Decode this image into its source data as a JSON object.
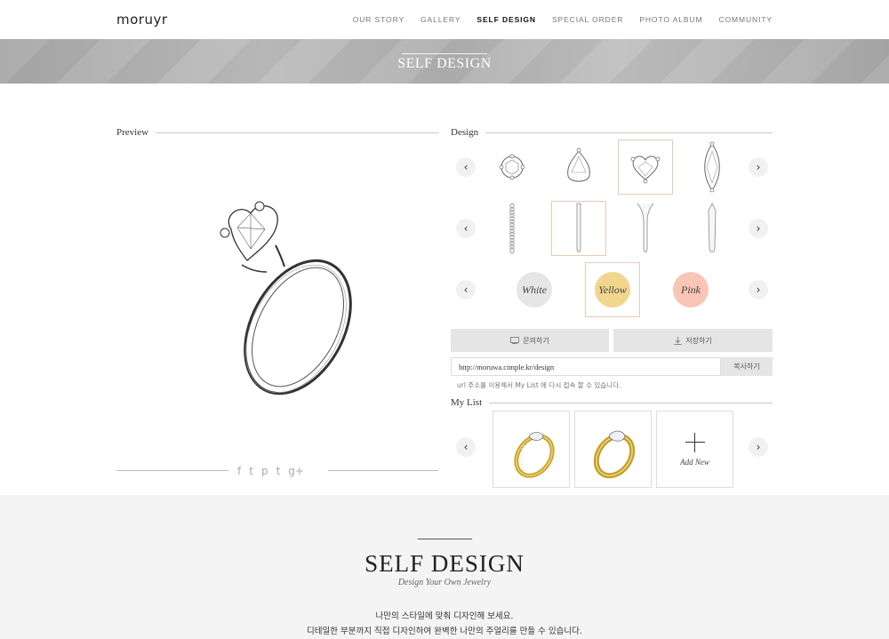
{
  "header": {
    "logo": "moruyr",
    "nav": [
      "OUR STORY",
      "GALLERY",
      "SELF DESIGN",
      "SPECIAL ORDER",
      "PHOTO ALBUM",
      "COMMUNITY"
    ],
    "active_nav": "SELF DESIGN"
  },
  "banner": {
    "title": "SELF DESIGN"
  },
  "preview": {
    "heading": "Preview",
    "share_icons": [
      "facebook-icon",
      "twitter-icon",
      "pinterest-icon",
      "tumblr-icon",
      "google-plus-icon"
    ],
    "share_glyphs": [
      "f",
      "t",
      "p",
      "t",
      "g+"
    ]
  },
  "design": {
    "heading": "Design",
    "shapes": [
      "round",
      "pear",
      "heart",
      "marquise"
    ],
    "selected_shape": "heart",
    "bands": [
      "pave",
      "plain-selected",
      "split",
      "tapered"
    ],
    "colors": [
      {
        "label": "White",
        "hex": "#e6e6e6"
      },
      {
        "label": "Yellow",
        "hex": "#f2d68d"
      },
      {
        "label": "Pink",
        "hex": "#f8c5b6"
      }
    ],
    "selected_color": "Yellow",
    "prev_glyph": "‹",
    "next_glyph": "›"
  },
  "actions": {
    "inquiry_label": "문의하기",
    "save_label": "저장하기",
    "url_value": "http://moruwa.cimple.kr/design",
    "copy_label": "복사하기",
    "url_note": "url 주소를 이용해서 My List 에 다시 접속 할 수 있습니다."
  },
  "mylist": {
    "heading": "My List",
    "add_label": "Add New"
  },
  "footer": {
    "title": "SELF DESIGN",
    "subtitle": "Design Your Own Jewelry",
    "line1": "나만의 스타일에 맞춰 디자인해 보세요.",
    "line2": "디테일한 부분까지 직접 디자인하여 완벽한 나만의 주얼리를 만들 수 있습니다."
  },
  "colors": {
    "accent_border": "#eac9b7",
    "gold": "#c9a633",
    "banner_gray": "#b2b2b2"
  }
}
